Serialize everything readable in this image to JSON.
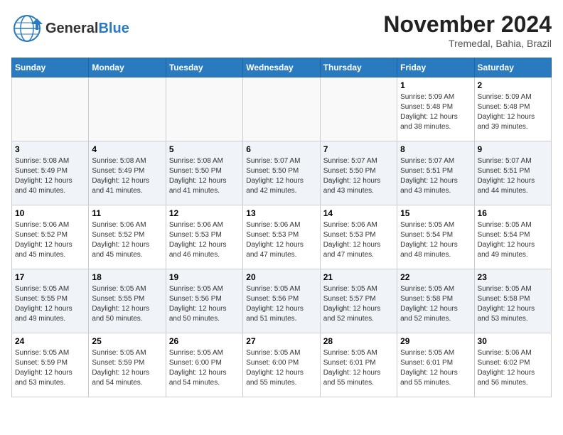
{
  "header": {
    "logo_line1": "General",
    "logo_line2": "Blue",
    "month": "November 2024",
    "location": "Tremedal, Bahia, Brazil"
  },
  "weekdays": [
    "Sunday",
    "Monday",
    "Tuesday",
    "Wednesday",
    "Thursday",
    "Friday",
    "Saturday"
  ],
  "weeks": [
    [
      {
        "day": "",
        "info": ""
      },
      {
        "day": "",
        "info": ""
      },
      {
        "day": "",
        "info": ""
      },
      {
        "day": "",
        "info": ""
      },
      {
        "day": "",
        "info": ""
      },
      {
        "day": "1",
        "info": "Sunrise: 5:09 AM\nSunset: 5:48 PM\nDaylight: 12 hours and 38 minutes."
      },
      {
        "day": "2",
        "info": "Sunrise: 5:09 AM\nSunset: 5:48 PM\nDaylight: 12 hours and 39 minutes."
      }
    ],
    [
      {
        "day": "3",
        "info": "Sunrise: 5:08 AM\nSunset: 5:49 PM\nDaylight: 12 hours and 40 minutes."
      },
      {
        "day": "4",
        "info": "Sunrise: 5:08 AM\nSunset: 5:49 PM\nDaylight: 12 hours and 41 minutes."
      },
      {
        "day": "5",
        "info": "Sunrise: 5:08 AM\nSunset: 5:50 PM\nDaylight: 12 hours and 41 minutes."
      },
      {
        "day": "6",
        "info": "Sunrise: 5:07 AM\nSunset: 5:50 PM\nDaylight: 12 hours and 42 minutes."
      },
      {
        "day": "7",
        "info": "Sunrise: 5:07 AM\nSunset: 5:50 PM\nDaylight: 12 hours and 43 minutes."
      },
      {
        "day": "8",
        "info": "Sunrise: 5:07 AM\nSunset: 5:51 PM\nDaylight: 12 hours and 43 minutes."
      },
      {
        "day": "9",
        "info": "Sunrise: 5:07 AM\nSunset: 5:51 PM\nDaylight: 12 hours and 44 minutes."
      }
    ],
    [
      {
        "day": "10",
        "info": "Sunrise: 5:06 AM\nSunset: 5:52 PM\nDaylight: 12 hours and 45 minutes."
      },
      {
        "day": "11",
        "info": "Sunrise: 5:06 AM\nSunset: 5:52 PM\nDaylight: 12 hours and 45 minutes."
      },
      {
        "day": "12",
        "info": "Sunrise: 5:06 AM\nSunset: 5:53 PM\nDaylight: 12 hours and 46 minutes."
      },
      {
        "day": "13",
        "info": "Sunrise: 5:06 AM\nSunset: 5:53 PM\nDaylight: 12 hours and 47 minutes."
      },
      {
        "day": "14",
        "info": "Sunrise: 5:06 AM\nSunset: 5:53 PM\nDaylight: 12 hours and 47 minutes."
      },
      {
        "day": "15",
        "info": "Sunrise: 5:05 AM\nSunset: 5:54 PM\nDaylight: 12 hours and 48 minutes."
      },
      {
        "day": "16",
        "info": "Sunrise: 5:05 AM\nSunset: 5:54 PM\nDaylight: 12 hours and 49 minutes."
      }
    ],
    [
      {
        "day": "17",
        "info": "Sunrise: 5:05 AM\nSunset: 5:55 PM\nDaylight: 12 hours and 49 minutes."
      },
      {
        "day": "18",
        "info": "Sunrise: 5:05 AM\nSunset: 5:55 PM\nDaylight: 12 hours and 50 minutes."
      },
      {
        "day": "19",
        "info": "Sunrise: 5:05 AM\nSunset: 5:56 PM\nDaylight: 12 hours and 50 minutes."
      },
      {
        "day": "20",
        "info": "Sunrise: 5:05 AM\nSunset: 5:56 PM\nDaylight: 12 hours and 51 minutes."
      },
      {
        "day": "21",
        "info": "Sunrise: 5:05 AM\nSunset: 5:57 PM\nDaylight: 12 hours and 52 minutes."
      },
      {
        "day": "22",
        "info": "Sunrise: 5:05 AM\nSunset: 5:58 PM\nDaylight: 12 hours and 52 minutes."
      },
      {
        "day": "23",
        "info": "Sunrise: 5:05 AM\nSunset: 5:58 PM\nDaylight: 12 hours and 53 minutes."
      }
    ],
    [
      {
        "day": "24",
        "info": "Sunrise: 5:05 AM\nSunset: 5:59 PM\nDaylight: 12 hours and 53 minutes."
      },
      {
        "day": "25",
        "info": "Sunrise: 5:05 AM\nSunset: 5:59 PM\nDaylight: 12 hours and 54 minutes."
      },
      {
        "day": "26",
        "info": "Sunrise: 5:05 AM\nSunset: 6:00 PM\nDaylight: 12 hours and 54 minutes."
      },
      {
        "day": "27",
        "info": "Sunrise: 5:05 AM\nSunset: 6:00 PM\nDaylight: 12 hours and 55 minutes."
      },
      {
        "day": "28",
        "info": "Sunrise: 5:05 AM\nSunset: 6:01 PM\nDaylight: 12 hours and 55 minutes."
      },
      {
        "day": "29",
        "info": "Sunrise: 5:05 AM\nSunset: 6:01 PM\nDaylight: 12 hours and 55 minutes."
      },
      {
        "day": "30",
        "info": "Sunrise: 5:06 AM\nSunset: 6:02 PM\nDaylight: 12 hours and 56 minutes."
      }
    ]
  ]
}
